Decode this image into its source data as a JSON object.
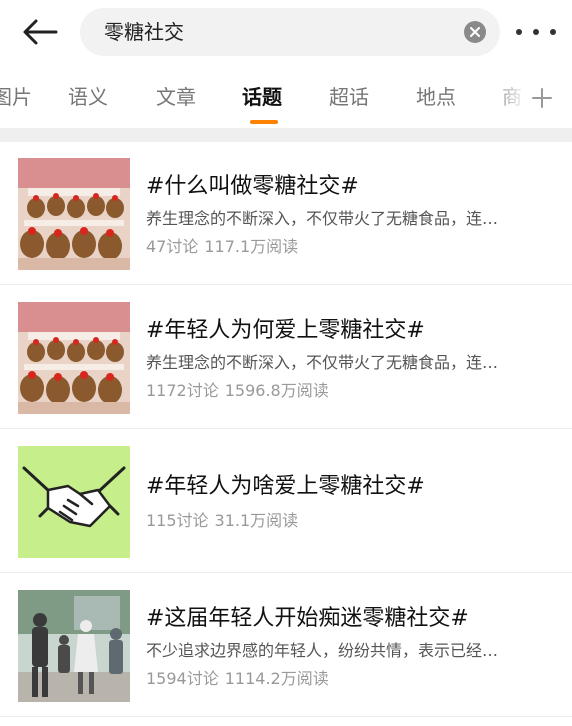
{
  "search": {
    "query": "零糖社交"
  },
  "tabs": [
    {
      "label": "图片"
    },
    {
      "label": "语义"
    },
    {
      "label": "文章"
    },
    {
      "label": "话题"
    },
    {
      "label": "超话"
    },
    {
      "label": "地点"
    },
    {
      "label": "商"
    }
  ],
  "active_tab": "话题",
  "colors": {
    "accent": "#ff8200",
    "thumb_green": "#c6ef8c"
  },
  "icons": {
    "back": "back-arrow-icon",
    "clear": "clear-icon",
    "more": "more-icon",
    "add": "plus-icon"
  },
  "topics": [
    {
      "title": "#什么叫做零糖社交#",
      "desc": "养生理念的不断深入，不仅带火了无糖食品，连…",
      "discussions": "47讨论",
      "reads": "117.1万阅读"
    },
    {
      "title": "#年轻人为何爱上零糖社交#",
      "desc": "养生理念的不断深入，不仅带火了无糖食品，连…",
      "discussions": "1172讨论",
      "reads": "1596.8万阅读"
    },
    {
      "title": "#年轻人为啥爱上零糖社交#",
      "desc": "",
      "discussions": "115讨论",
      "reads": "31.1万阅读"
    },
    {
      "title": "#这届年轻人开始痴迷零糖社交#",
      "desc": "不少追求边界感的年轻人，纷纷共情，表示已经…",
      "discussions": "1594讨论",
      "reads": "1114.2万阅读"
    }
  ]
}
